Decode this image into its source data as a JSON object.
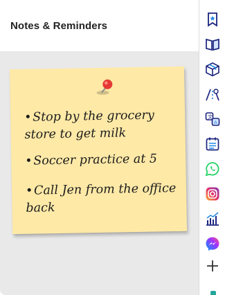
{
  "panel": {
    "title": "Notes & Reminders"
  },
  "note": {
    "color": "#fee9a7",
    "pin_color": "#e53935",
    "items": [
      "Stop by the grocery store to get milk",
      "Soccer practice at 5",
      "Call Jen from the office back"
    ]
  },
  "sidebar": {
    "icons": [
      "bookmark-star-icon",
      "reading-book-icon",
      "package-box-icon",
      "road-map-icon",
      "translate-icon",
      "calendar-icon",
      "whatsapp-icon",
      "instagram-icon",
      "chart-icon",
      "messenger-icon",
      "add-icon"
    ]
  },
  "colors": {
    "whatsapp": "#25d366",
    "instagram": "#e1306c",
    "messenger": "#5b5cf6",
    "ink": "#1c1c1c"
  }
}
